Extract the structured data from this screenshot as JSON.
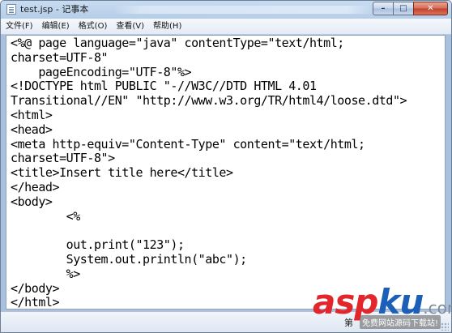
{
  "window": {
    "title": "test.jsp - 记事本",
    "icon": "notepad-icon",
    "controls": {
      "minimize": "–",
      "maximize": "□",
      "close": "✕"
    }
  },
  "menu": {
    "items": [
      {
        "label": "文件(F)"
      },
      {
        "label": "编辑(E)"
      },
      {
        "label": "格式(O)"
      },
      {
        "label": "查看(V)"
      },
      {
        "label": "帮助(H)"
      }
    ]
  },
  "editor": {
    "lines": [
      "<%@ page language=\"java\" contentType=\"text/html;",
      "charset=UTF-8\"",
      "    pageEncoding=\"UTF-8\"%>",
      "<!DOCTYPE html PUBLIC \"-//W3C//DTD HTML 4.01",
      "Transitional//EN\" \"http://www.w3.org/TR/html4/loose.dtd\">",
      "<html>",
      "<head>",
      "<meta http-equiv=\"Content-Type\" content=\"text/html;",
      "charset=UTF-8\">",
      "<title>Insert title here</title>",
      "</head>",
      "<body>",
      "        <%",
      "",
      "        out.print(\"123\");",
      "        System.out.println(\"abc\");",
      "        %>",
      "</body>",
      "</html>"
    ]
  },
  "statusbar": {
    "text": "第"
  },
  "watermark": {
    "brand_red": "asp",
    "brand_blue": "ku",
    "brand_suffix": ".com",
    "slogan": "免费网站源码下载站!",
    "colors": {
      "red": "#e2262b",
      "blue": "#1b5fb8"
    }
  }
}
